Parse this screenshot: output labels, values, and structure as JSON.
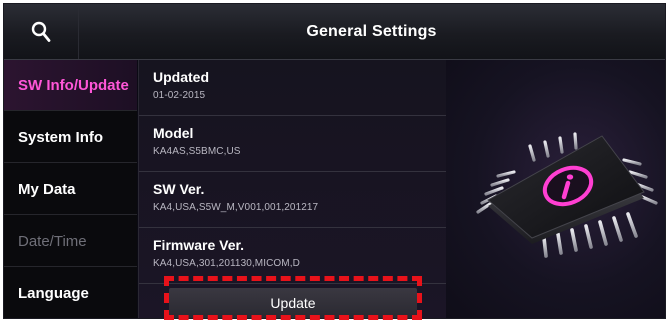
{
  "header": {
    "title": "General Settings",
    "search_icon": "search-icon"
  },
  "sidebar": {
    "items": [
      {
        "label": "SW Info/Update",
        "state": "active"
      },
      {
        "label": "System Info",
        "state": "normal"
      },
      {
        "label": "My Data",
        "state": "normal"
      },
      {
        "label": "Date/Time",
        "state": "disabled"
      },
      {
        "label": "Language",
        "state": "normal"
      }
    ]
  },
  "info": {
    "rows": [
      {
        "label": "Updated",
        "value": "01-02-2015"
      },
      {
        "label": "Model",
        "value": "KA4AS,S5BMC,US"
      },
      {
        "label": "SW Ver.",
        "value": "KA4,USA,S5W_M,V001,001,201217"
      },
      {
        "label": "Firmware Ver.",
        "value": "KA4,USA,301,201130,MICOM,D"
      }
    ],
    "update_label": "Update"
  },
  "graphic": {
    "icon": "info-chip-icon"
  },
  "colors": {
    "accent": "#ff56d8",
    "highlight": "#e8121a",
    "background": "#0b0a14"
  }
}
